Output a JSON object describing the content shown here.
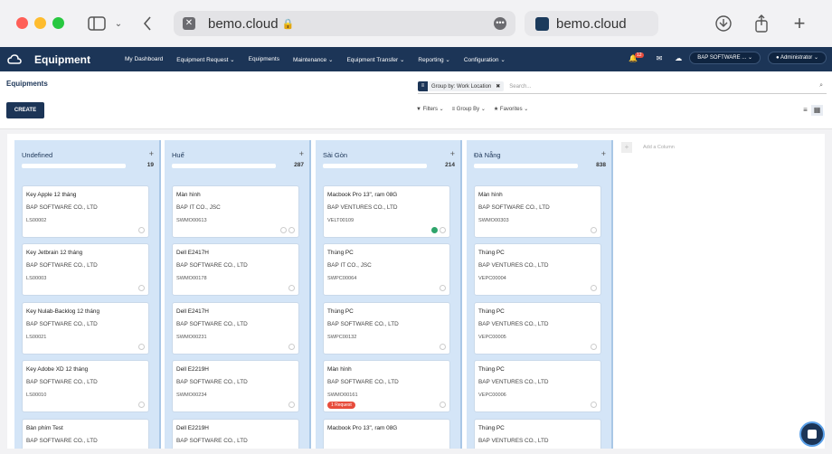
{
  "browser": {
    "url": "bemo.cloud",
    "other_tab": "bemo.cloud"
  },
  "nav": {
    "brand": "Equipment",
    "menu": [
      "My Dashboard",
      "Equipment Request ⌄",
      "Equipments",
      "Maintenance ⌄",
      "Equipment Transfer ⌄",
      "Reporting ⌄",
      "Configuration ⌄"
    ],
    "notifications": "12",
    "company": "BAP SOFTWARE ...",
    "user": "Administrator"
  },
  "control": {
    "title": "Equipments",
    "create_label": "CREATE",
    "facet": "Group by: Work Location",
    "search_placeholder": "Search...",
    "filters": "▼ Filters ⌄",
    "groupby": "≡ Group By ⌄",
    "favorites": "★ Favorites ⌄"
  },
  "columns": [
    {
      "name": "Undefined",
      "count": "19",
      "cards": [
        {
          "name": "Key Apple 12 tháng",
          "company": "BAP SOFTWARE CO., LTD",
          "ref": "LS00002"
        },
        {
          "name": "Key Jetbrain 12 tháng",
          "company": "BAP SOFTWARE CO., LTD",
          "ref": "LS00003"
        },
        {
          "name": "Key Nulab-Backlog 12 tháng",
          "company": "BAP SOFTWARE CO., LTD",
          "ref": "LS00021"
        },
        {
          "name": "Key Adobe XD 12 tháng",
          "company": "BAP SOFTWARE CO., LTD",
          "ref": "LS00010"
        },
        {
          "name": "Bàn phím Test",
          "company": "BAP SOFTWARE CO., LTD",
          "ref": ""
        }
      ]
    },
    {
      "name": "Huế",
      "count": "287",
      "cards": [
        {
          "name": "Màn hình",
          "company": "BAP IT CO., JSC",
          "ref": "SWMO00613"
        },
        {
          "name": "Dell E2417H",
          "company": "BAP SOFTWARE CO., LTD",
          "ref": "SWMO00178"
        },
        {
          "name": "Dell E2417H",
          "company": "BAP SOFTWARE CO., LTD",
          "ref": "SWMO00231"
        },
        {
          "name": "Dell E2219H",
          "company": "BAP SOFTWARE CO., LTD",
          "ref": "SWMO00234"
        },
        {
          "name": "Dell E2219H",
          "company": "BAP SOFTWARE CO., LTD",
          "ref": ""
        }
      ]
    },
    {
      "name": "Sài Gòn",
      "count": "214",
      "cards": [
        {
          "name": "Macbook Pro 13\", ram 08G",
          "company": "BAP VENTURES CO., LTD",
          "ref": "VELT00109"
        },
        {
          "name": "Thùng PC",
          "company": "BAP IT CO., JSC",
          "ref": "SWPC00064"
        },
        {
          "name": "Thùng PC",
          "company": "BAP SOFTWARE CO., LTD",
          "ref": "SWPC00132"
        },
        {
          "name": "Màn hình",
          "company": "BAP SOFTWARE CO., LTD",
          "ref": "SWMO00161",
          "badge": "1 Request"
        },
        {
          "name": "Macbook Pro 13\", ram 08G",
          "company": "",
          "ref": ""
        }
      ]
    },
    {
      "name": "Đà Nẵng",
      "count": "838",
      "cards": [
        {
          "name": "Màn hình",
          "company": "BAP SOFTWARE CO., LTD",
          "ref": "SWMO00303"
        },
        {
          "name": "Thùng PC",
          "company": "BAP VENTURES CO., LTD",
          "ref": "VEPC00004"
        },
        {
          "name": "Thùng PC",
          "company": "BAP VENTURES CO., LTD",
          "ref": "VEPC00005"
        },
        {
          "name": "Thùng PC",
          "company": "BAP VENTURES CO., LTD",
          "ref": "VEPC00006"
        },
        {
          "name": "Thùng PC",
          "company": "BAP VENTURES CO., LTD",
          "ref": ""
        }
      ]
    }
  ],
  "add_column": "Add a Column"
}
